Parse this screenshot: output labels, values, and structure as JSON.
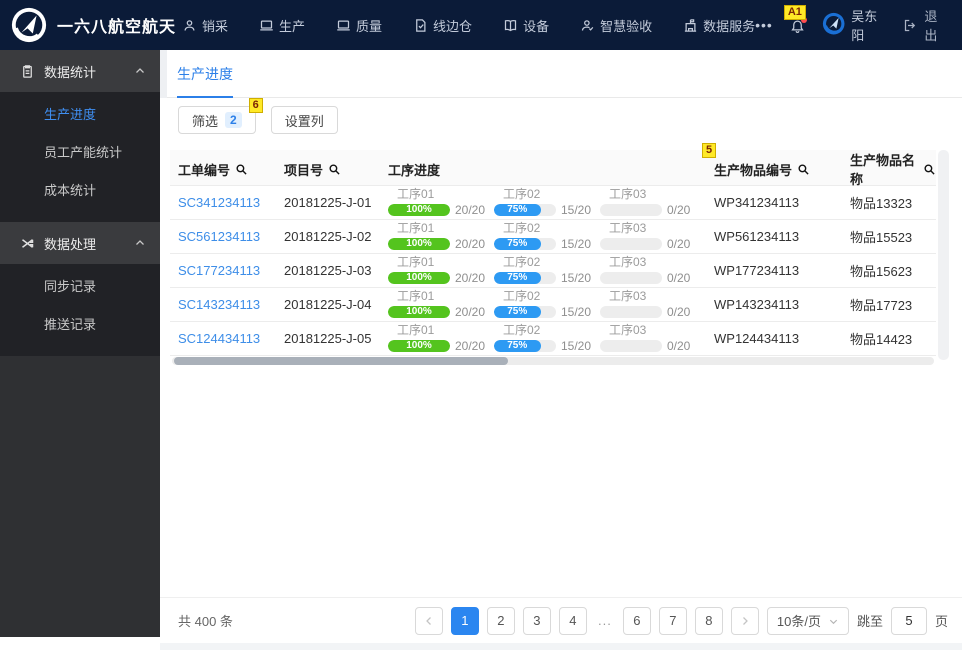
{
  "navbar": {
    "brand": "一六八航空航天",
    "menu": [
      {
        "label": "销采",
        "icon": "user-icon"
      },
      {
        "label": "生产",
        "icon": "laptop-icon"
      },
      {
        "label": "质量",
        "icon": "laptop-icon"
      },
      {
        "label": "线边仓",
        "icon": "document-icon"
      },
      {
        "label": "设备",
        "icon": "book-icon"
      },
      {
        "label": "智慧验收",
        "icon": "user-check-icon"
      },
      {
        "label": "数据服务",
        "icon": "building-icon"
      }
    ],
    "user_name": "吴东阳",
    "logout_label": "退出",
    "annotation_a1": "A1"
  },
  "sidebar": {
    "groups": [
      {
        "label": "数据统计",
        "icon": "clipboard-icon",
        "items": [
          "生产进度",
          "员工产能统计",
          "成本统计"
        ]
      },
      {
        "label": "数据处理",
        "icon": "shuffle-icon",
        "items": [
          "同步记录",
          "推送记录"
        ]
      }
    ],
    "active_item": "生产进度"
  },
  "tab": {
    "label": "生产进度"
  },
  "toolbar": {
    "filter_label": "筛选",
    "filter_count": "2",
    "columns_label": "设置列",
    "annotation_6": "6"
  },
  "table": {
    "annotation_5": "5",
    "headers": {
      "order": "工单编号",
      "project": "项目号",
      "progress": "工序进度",
      "item_no": "生产物品编号",
      "item_name": "生产物品名称"
    },
    "rows": [
      {
        "order": "SC341234113",
        "project": "20181225-J-01",
        "item_no": "WP341234113",
        "item_name": "物品13323",
        "steps": [
          {
            "name": "工序01",
            "percent": 100,
            "percent_label": "100%",
            "fraction": "20/20",
            "color": "#54c41e"
          },
          {
            "name": "工序02",
            "percent": 75,
            "percent_label": "75%",
            "fraction": "15/20",
            "color": "#2d9af3"
          },
          {
            "name": "工序03",
            "percent": 0,
            "percent_label": "",
            "fraction": "0/20",
            "color": "#ededed"
          }
        ]
      },
      {
        "order": "SC561234113",
        "project": "20181225-J-02",
        "item_no": "WP561234113",
        "item_name": "物品15523",
        "steps": [
          {
            "name": "工序01",
            "percent": 100,
            "percent_label": "100%",
            "fraction": "20/20",
            "color": "#54c41e"
          },
          {
            "name": "工序02",
            "percent": 75,
            "percent_label": "75%",
            "fraction": "15/20",
            "color": "#2d9af3"
          },
          {
            "name": "工序03",
            "percent": 0,
            "percent_label": "",
            "fraction": "0/20",
            "color": "#ededed"
          }
        ]
      },
      {
        "order": "SC177234113",
        "project": "20181225-J-03",
        "item_no": "WP177234113",
        "item_name": "物品15623",
        "steps": [
          {
            "name": "工序01",
            "percent": 100,
            "percent_label": "100%",
            "fraction": "20/20",
            "color": "#54c41e"
          },
          {
            "name": "工序02",
            "percent": 75,
            "percent_label": "75%",
            "fraction": "15/20",
            "color": "#2d9af3"
          },
          {
            "name": "工序03",
            "percent": 0,
            "percent_label": "",
            "fraction": "0/20",
            "color": "#ededed"
          }
        ]
      },
      {
        "order": "SC143234113",
        "project": "20181225-J-04",
        "item_no": "WP143234113",
        "item_name": "物品17723",
        "steps": [
          {
            "name": "工序01",
            "percent": 100,
            "percent_label": "100%",
            "fraction": "20/20",
            "color": "#54c41e"
          },
          {
            "name": "工序02",
            "percent": 75,
            "percent_label": "75%",
            "fraction": "15/20",
            "color": "#2d9af3"
          },
          {
            "name": "工序03",
            "percent": 0,
            "percent_label": "",
            "fraction": "0/20",
            "color": "#ededed"
          }
        ]
      },
      {
        "order": "SC124434113",
        "project": "20181225-J-05",
        "item_no": "WP124434113",
        "item_name": "物品14423",
        "steps": [
          {
            "name": "工序01",
            "percent": 100,
            "percent_label": "100%",
            "fraction": "20/20",
            "color": "#54c41e"
          },
          {
            "name": "工序02",
            "percent": 75,
            "percent_label": "75%",
            "fraction": "15/20",
            "color": "#2d9af3"
          },
          {
            "name": "工序03",
            "percent": 0,
            "percent_label": "",
            "fraction": "0/20",
            "color": "#ededed"
          }
        ]
      }
    ]
  },
  "pagination": {
    "total": "共 400 条",
    "pages": [
      "1",
      "2",
      "3",
      "4",
      "...",
      "6",
      "7",
      "8"
    ],
    "active_page": "1",
    "page_size": "10条/页",
    "jump_label": "跳至",
    "jump_value": "5",
    "jump_suffix": "页"
  },
  "colors": {
    "navbar_bg": "#0b1b38",
    "accent_blue": "#2b7fe8",
    "progress_green": "#54c41e",
    "progress_blue": "#2d9af3",
    "annotation_yellow": "#ffe927"
  }
}
